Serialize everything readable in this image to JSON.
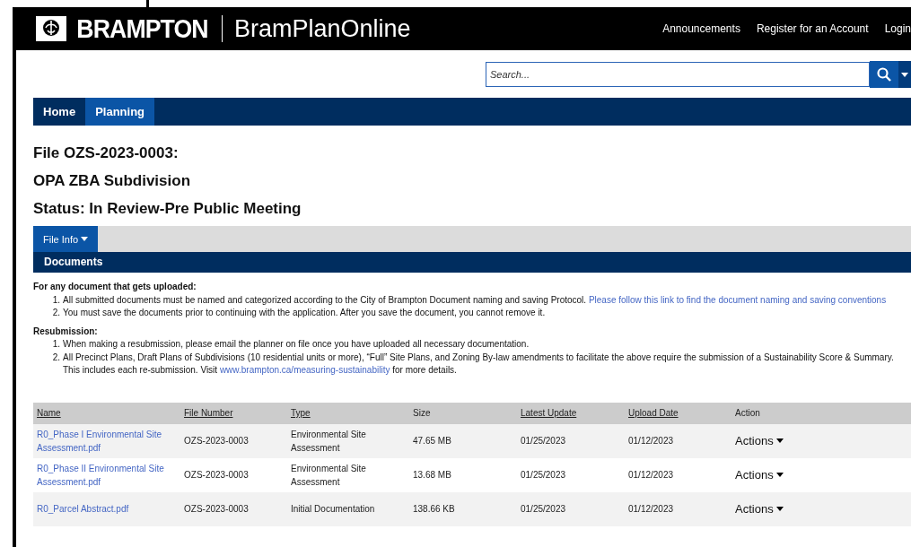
{
  "header": {
    "logo": "BRAMPTON",
    "app_name": "BramPlanOnline",
    "links": [
      "Announcements",
      "Register for an Account",
      "Login"
    ]
  },
  "search": {
    "placeholder": "Search..."
  },
  "nav": [
    {
      "label": "Home",
      "selected": false
    },
    {
      "label": "Planning",
      "selected": true
    }
  ],
  "file": {
    "title": "File OZS-2023-0003:",
    "type": "OPA ZBA Subdivision",
    "status": "Status: In Review-Pre Public Meeting"
  },
  "subtabs": [
    {
      "label": "File Info",
      "selected": true
    }
  ],
  "section_title": "Documents",
  "notes": [
    {
      "heading": "For any document that gets uploaded:",
      "items": [
        {
          "marker": "1.",
          "text": "All submitted documents must be named and categorized according to the City of Brampton Document naming and saving Protocol.",
          "link": "Please follow this link to find the document naming and saving conventions"
        },
        {
          "marker": "2.",
          "text": "You must save the documents prior to continuing with the application. After you save the document, you cannot remove it."
        }
      ]
    },
    {
      "heading": "Resubmission:",
      "items": [
        {
          "marker": "1.",
          "text": "When making a resubmission, please email the planner on file once you have uploaded all necessary documentation."
        },
        {
          "marker": "2.",
          "text": "All Precinct Plans, Draft Plans of Subdivisions (10 residential units or more), “Full” Site Plans, and Zoning By-law amendments to facilitate the above require the submission of a Sustainability Score & Summary. This includes each re-submission. Visit",
          "link": "www.brampton.ca/measuring-sustainability",
          "after": "for more details."
        }
      ]
    }
  ],
  "table": {
    "columns": [
      {
        "label": "Name",
        "sortable": true
      },
      {
        "label": "File Number",
        "sortable": true
      },
      {
        "label": "Type",
        "sortable": true
      },
      {
        "label": "Size",
        "sortable": false
      },
      {
        "label": "Latest Update",
        "sortable": true
      },
      {
        "label": "Upload Date",
        "sortable": true
      },
      {
        "label": "Action",
        "sortable": false
      }
    ],
    "rows": [
      {
        "name": "R0_Phase I Environmental Site Assessment.pdf",
        "file_number": "OZS-2023-0003",
        "type": "Environmental Site Assessment",
        "size": "47.65 MB",
        "latest_update": "01/25/2023",
        "upload_date": "01/12/2023",
        "action": "Actions"
      },
      {
        "name": "R0_Phase II Environmental Site Assessment.pdf",
        "file_number": "OZS-2023-0003",
        "type": "Environmental Site Assessment",
        "size": "13.68 MB",
        "latest_update": "01/25/2023",
        "upload_date": "01/12/2023",
        "action": "Actions"
      },
      {
        "name": "R0_Parcel Abstract.pdf",
        "file_number": "OZS-2023-0003",
        "type": "Initial Documentation",
        "size": "138.66 KB",
        "latest_update": "01/25/2023",
        "upload_date": "01/12/2023",
        "action": "Actions"
      }
    ]
  }
}
